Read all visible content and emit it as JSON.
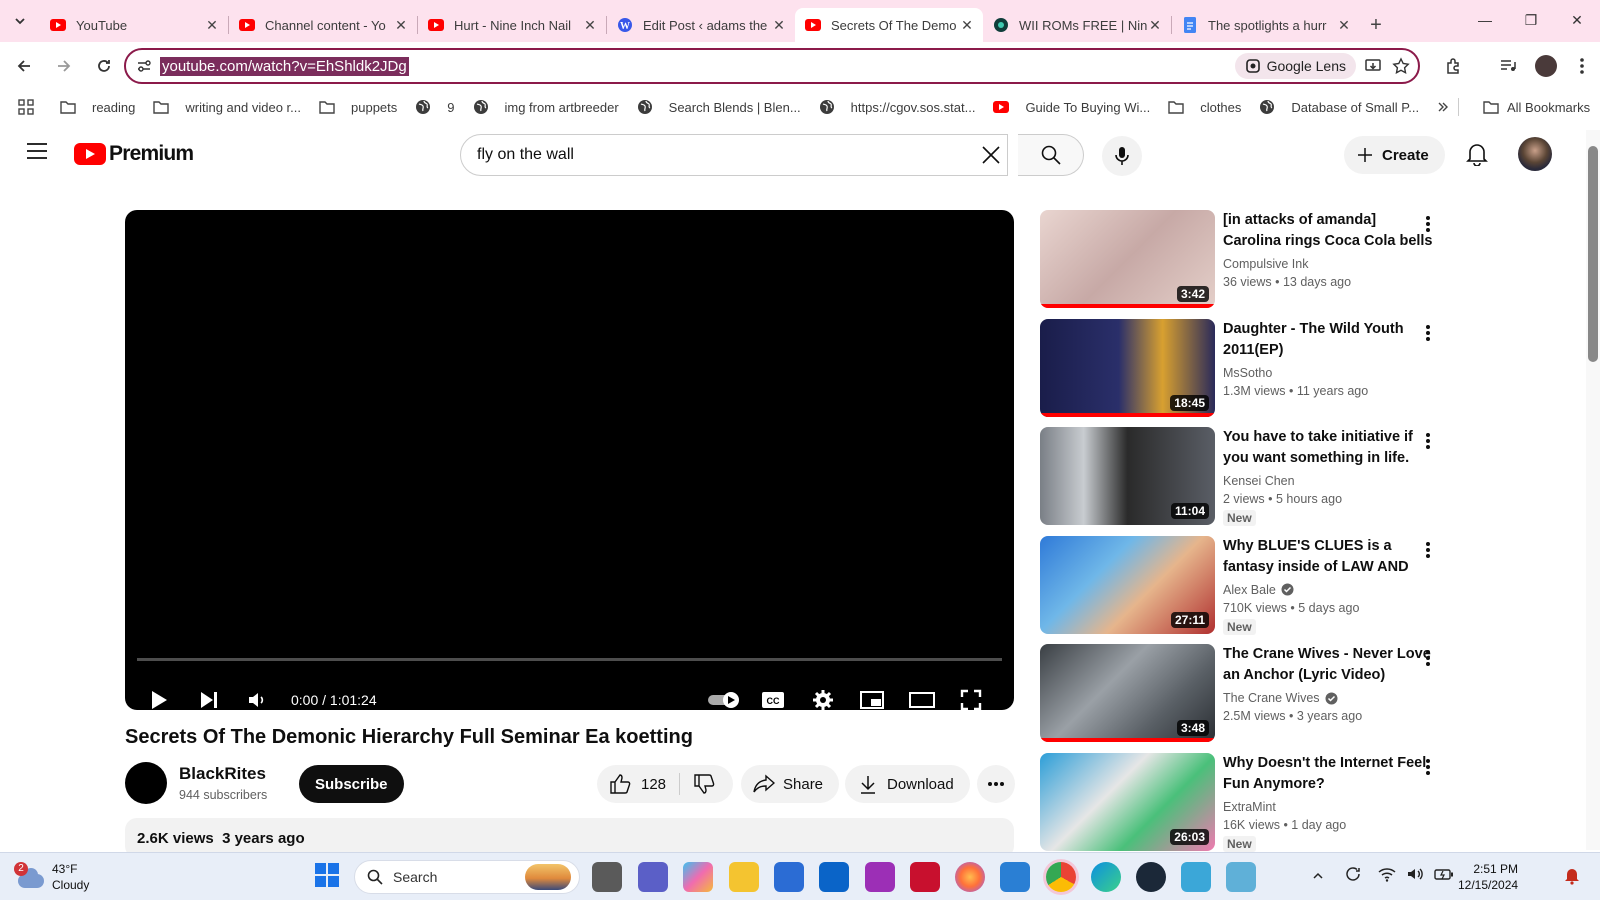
{
  "browser": {
    "tabs": [
      {
        "title": "YouTube",
        "icon": "youtube-icon"
      },
      {
        "title": "Channel content - Yo",
        "icon": "youtube-icon"
      },
      {
        "title": "Hurt - Nine Inch Nail",
        "icon": "youtube-icon"
      },
      {
        "title": "Edit Post ‹ adams the",
        "icon": "wordpress-icon"
      },
      {
        "title": "Secrets Of The Demo",
        "icon": "youtube-icon",
        "active": true
      },
      {
        "title": "WII ROMs FREE | Nin",
        "icon": "site-icon"
      },
      {
        "title": "The spotlights a hurr",
        "icon": "docs-icon"
      }
    ],
    "url": "youtube.com/watch?v=EhShldk2JDg",
    "lens_label": "Google Lens",
    "bookmarks": [
      {
        "label": "reading",
        "icon": "folder-icon"
      },
      {
        "label": "writing and video r...",
        "icon": "folder-icon"
      },
      {
        "label": "puppets",
        "icon": "folder-icon"
      },
      {
        "label": "9",
        "icon": "globe-icon"
      },
      {
        "label": "img from artbreeder",
        "icon": "globe-icon"
      },
      {
        "label": "Search Blends | Blen...",
        "icon": "globe-icon"
      },
      {
        "label": "https://cgov.sos.stat...",
        "icon": "globe-icon"
      },
      {
        "label": "Guide To Buying Wi...",
        "icon": "youtube-icon"
      },
      {
        "label": "clothes",
        "icon": "folder-icon"
      },
      {
        "label": "Database of Small P...",
        "icon": "globe-icon"
      }
    ],
    "all_bookmarks": "All Bookmarks"
  },
  "youtube": {
    "logo_text": "Premium",
    "search_value": "fly on the wall",
    "create_label": "Create",
    "player": {
      "time": "0:00 / 1:01:24"
    },
    "video": {
      "title": "Secrets Of The Demonic Hierarchy Full Seminar Ea koetting",
      "channel": "BlackRites",
      "subscribers": "944 subscribers",
      "subscribe_label": "Subscribe",
      "likes": "128",
      "share_label": "Share",
      "download_label": "Download",
      "views": "2.6K views",
      "age": "3 years ago"
    },
    "recommendations": [
      {
        "title": "[in attacks of amanda] Carolina rings Coca Cola bells (Amerili...",
        "channel": "Compulsive Ink",
        "meta": "36 views • 13 days ago",
        "duration": "3:42",
        "badge": "",
        "verified": false,
        "watched": 1.0
      },
      {
        "title": "Daughter - The Wild Youth 2011(EP)",
        "channel": "MsSotho",
        "meta": "1.3M views • 11 years ago",
        "duration": "18:45",
        "badge": "",
        "verified": false,
        "watched": 1.0
      },
      {
        "title": "You have to take initiative if you want something in life.",
        "channel": "Kensei Chen",
        "meta": "2 views • 5 hours ago",
        "duration": "11:04",
        "badge": "New",
        "verified": false,
        "watched": 0
      },
      {
        "title": "Why BLUE'S CLUES is a fantasy inside of LAW AND ORDER...",
        "channel": "Alex Bale",
        "meta": "710K views • 5 days ago",
        "duration": "27:11",
        "badge": "New",
        "verified": true,
        "watched": 0
      },
      {
        "title": "The Crane Wives - Never Love an Anchor (Lyric Video)",
        "channel": "The Crane Wives",
        "meta": "2.5M views • 3 years ago",
        "duration": "3:48",
        "badge": "",
        "verified": true,
        "watched": 1.0
      },
      {
        "title": "Why Doesn't the Internet Feel Fun Anymore?",
        "channel": "ExtraMint",
        "meta": "16K views • 1 day ago",
        "duration": "26:03",
        "badge": "New",
        "verified": false,
        "watched": 0
      }
    ]
  },
  "taskbar": {
    "weather_temp": "43°F",
    "weather_desc": "Cloudy",
    "weather_badge": "2",
    "search_label": "Search",
    "time": "2:51 PM",
    "date": "12/15/2024"
  },
  "colors": {
    "accent": "#8b1a4a",
    "youtube_red": "#ff0000",
    "tab_bar": "#fde2ee"
  }
}
